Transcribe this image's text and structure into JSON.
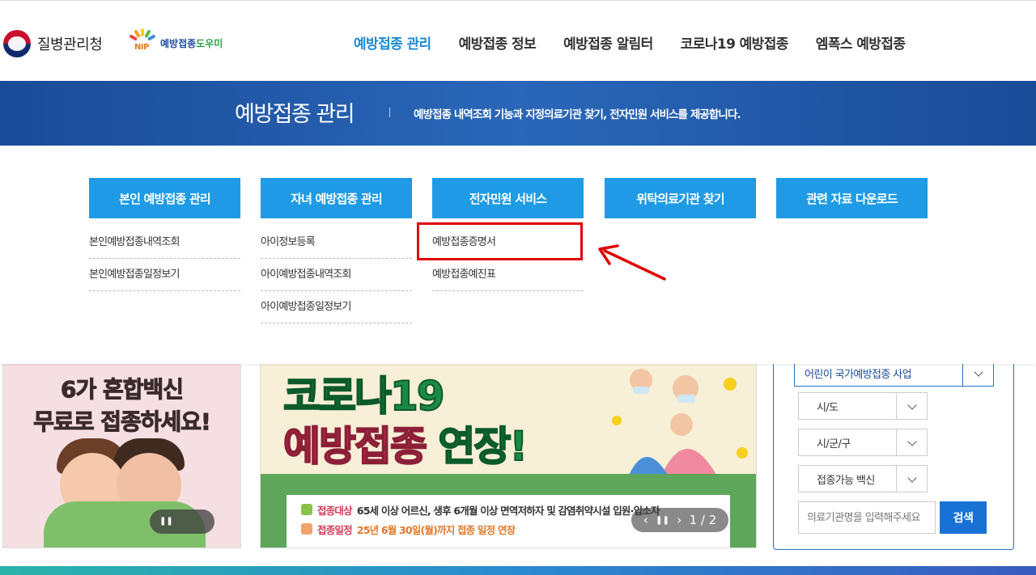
{
  "header": {
    "agency_name": "질병관리청",
    "nip_logo_text": "NIP",
    "nip_site_name_a": "예방접종",
    "nip_site_name_b": "도우미",
    "nav": [
      {
        "label": "예방접종 관리",
        "active": true
      },
      {
        "label": "예방접종 정보",
        "active": false
      },
      {
        "label": "예방접종 알림터",
        "active": false
      },
      {
        "label": "코로나19 예방접종",
        "active": false
      },
      {
        "label": "엠폭스 예방접종",
        "active": false
      }
    ]
  },
  "banner": {
    "title": "예방접종 관리",
    "description": "예방접종 내역조회 기능과 지정의료기관 찾기, 전자민원 서비스를 제공합니다."
  },
  "mega_menu": {
    "columns": [
      {
        "title": "본인 예방접종 관리",
        "items": [
          "본인예방접종내역조회",
          "본인예방접종일정보기"
        ]
      },
      {
        "title": "자녀 예방접종 관리",
        "items": [
          "아이정보등록",
          "아이예방접종내역조회",
          "아이예방접종일정보기"
        ]
      },
      {
        "title": "전자민원 서비스",
        "items": [
          "예방접종증명서",
          "예방접종예진표"
        ]
      },
      {
        "title": "위탁의료기관 찾기",
        "items": []
      },
      {
        "title": "관련 자료 다운로드",
        "items": []
      }
    ],
    "highlight_color": "#e00000"
  },
  "promo_left": {
    "line1": "6가 혼합백신",
    "line2": "무료로 접종하세요!"
  },
  "promo_mid": {
    "headline1": "코로나19",
    "headline2_a": "예방접종",
    "headline2_b": "연장!",
    "target_label": "접종대상",
    "target_value": "65세 이상 어르신, 생후 6개월 이상 면역저하자 및 감염취약시설 입원·입소자",
    "schedule_label": "접종일정",
    "schedule_value": "25년 6월 30일(월)까지 접종 일정 연장",
    "pager": "1 / 2"
  },
  "search_panel": {
    "program": "어린이 국가예방접종 사업",
    "sido": "시/도",
    "sigungu": "시/군/구",
    "vaccine": "접종가능 백신",
    "placeholder": "의료기관명을 입력해주세요",
    "button": "검색"
  },
  "colors": {
    "accent": "#1b8ad3",
    "menu_head": "#1e9be4",
    "banner": "#1f56a6",
    "search_button": "#1872d6"
  }
}
